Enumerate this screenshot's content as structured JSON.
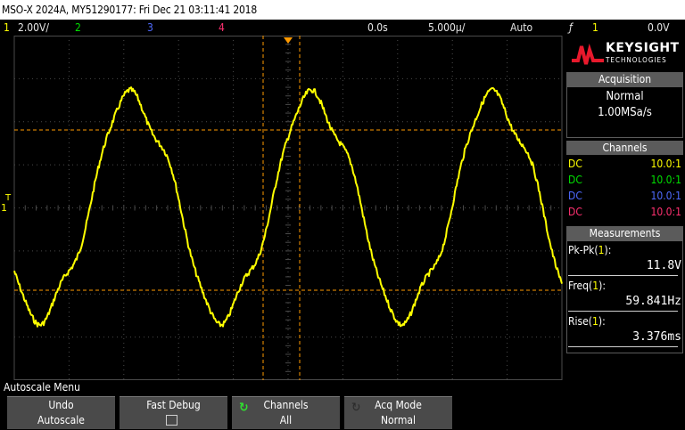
{
  "title": "MSO-X 2024A, MY51290177: Fri Dec 21 03:11:41 2018",
  "status": {
    "ch1_num": "1",
    "ch1_scale": "2.00V/",
    "ch2_num": "2",
    "ch3_num": "3",
    "ch4_num": "4",
    "time_delay": "0.0s",
    "time_scale": "5.000µ/",
    "trigger_mode": "Auto",
    "trigger_icon": "ƒ",
    "trigger_source": "1",
    "trigger_level": "0.0V"
  },
  "screen": {
    "trigger_marker": "T",
    "ground_marker": "1",
    "colors": {
      "trace": "#ffff00",
      "grid": "#4a4a4a",
      "cursor": "#ff9a00"
    }
  },
  "panel": {
    "brand_name": "KEYSIGHT",
    "brand_sub": "TECHNOLOGIES",
    "acquisition": {
      "header": "Acquisition",
      "mode": "Normal",
      "rate": "1.00MSa/s"
    },
    "channels": {
      "header": "Channels",
      "rows": [
        {
          "coupling": "DC",
          "ratio": "10.0:1",
          "color": "#ffff00"
        },
        {
          "coupling": "DC",
          "ratio": "10.0:1",
          "color": "#00e000"
        },
        {
          "coupling": "DC",
          "ratio": "10.0:1",
          "color": "#4f6bff"
        },
        {
          "coupling": "DC",
          "ratio": "10.0:1",
          "color": "#ff3070"
        }
      ]
    },
    "measurements": {
      "header": "Measurements",
      "items": [
        {
          "label_pre": "Pk-Pk(",
          "src": "1",
          "label_post": "):",
          "value": "11.8V"
        },
        {
          "label_pre": "Freq(",
          "src": "1",
          "label_post": "):",
          "value": "59.841Hz"
        },
        {
          "label_pre": "Rise(",
          "src": "1",
          "label_post": "):",
          "value": "3.376ms"
        }
      ]
    }
  },
  "softkeys": {
    "menu_label": "Autoscale Menu",
    "keys": [
      {
        "line1": "Undo",
        "line2": "Autoscale"
      },
      {
        "line1": "Fast Debug",
        "line2": ""
      },
      {
        "line1": "Channels",
        "line2": "All"
      },
      {
        "line1": "Acq Mode",
        "line2": "Normal"
      }
    ]
  }
}
